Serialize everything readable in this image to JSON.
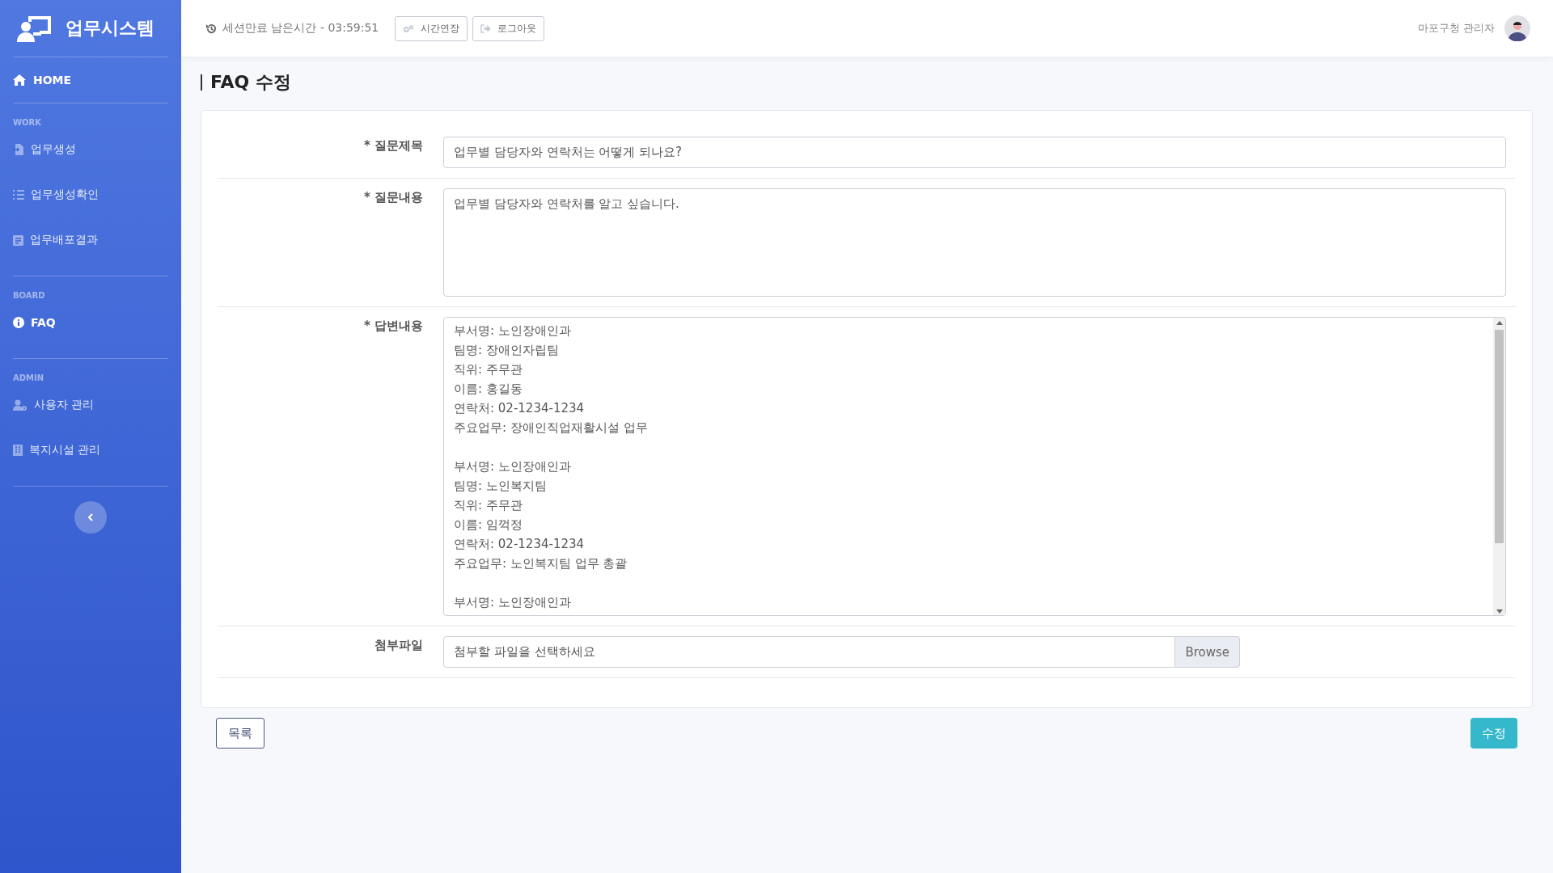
{
  "sidebar": {
    "brand": "업무시스템",
    "home": "HOME",
    "sections": [
      {
        "heading": "WORK",
        "items": [
          {
            "label": "업무생성",
            "kind": "file",
            "selected": false
          },
          {
            "label": "업무생성확인",
            "kind": "list",
            "selected": false
          },
          {
            "label": "업무배포결과",
            "kind": "doc",
            "selected": false
          }
        ]
      },
      {
        "heading": "BOARD",
        "items": [
          {
            "label": "FAQ",
            "kind": "info",
            "selected": true
          }
        ]
      },
      {
        "heading": "ADMIN",
        "items": [
          {
            "label": "사용자 관리",
            "kind": "user",
            "selected": false
          },
          {
            "label": "복지시설 관리",
            "kind": "building",
            "selected": false
          }
        ]
      }
    ]
  },
  "header": {
    "session": "세션만료 남은시간 - 03:59:51",
    "buttons": [
      {
        "label": "시간연장",
        "kind": "extend"
      },
      {
        "label": "로그아웃",
        "kind": "logout"
      }
    ],
    "user": "마포구청 관리자"
  },
  "page_title": "FAQ 수정",
  "form": {
    "fields": [
      {
        "kind": "input",
        "label": "* 질문제목",
        "value": "업무별 담당자와 연락처는 어떻게 되나요?"
      },
      {
        "kind": "textarea",
        "label": "* 질문내용",
        "value": "업무별 담당자와 연락처를 알고 싶습니다."
      },
      {
        "kind": "scroll",
        "label": "* 답변내용",
        "groups": [
          {
            "lines": [
              "부서명: 노인장애인과",
              "팀명: 장애인자립팀",
              "직위: 주무관",
              "이름: 홍길동",
              "연락처: 02-1234-1234",
              "주요업무: 장애인직업재활시설 업무"
            ]
          },
          {
            "lines": [
              "부서명: 노인장애인과",
              "팀명:  노인복지팀",
              "직위: 주무관",
              "이름:  임꺽정",
              "연락처: 02-1234-1234",
              "주요업무: 노인복지팀 업무 총괄"
            ]
          },
          {
            "lines": [
              "부서명: 노인장애인과"
            ]
          }
        ]
      },
      {
        "kind": "file",
        "label": "첨부파일",
        "placeholder": "첨부할 파일을 선택하세요",
        "button": "Browse"
      }
    ]
  },
  "actions": {
    "back": "목록",
    "submit": "수정"
  }
}
